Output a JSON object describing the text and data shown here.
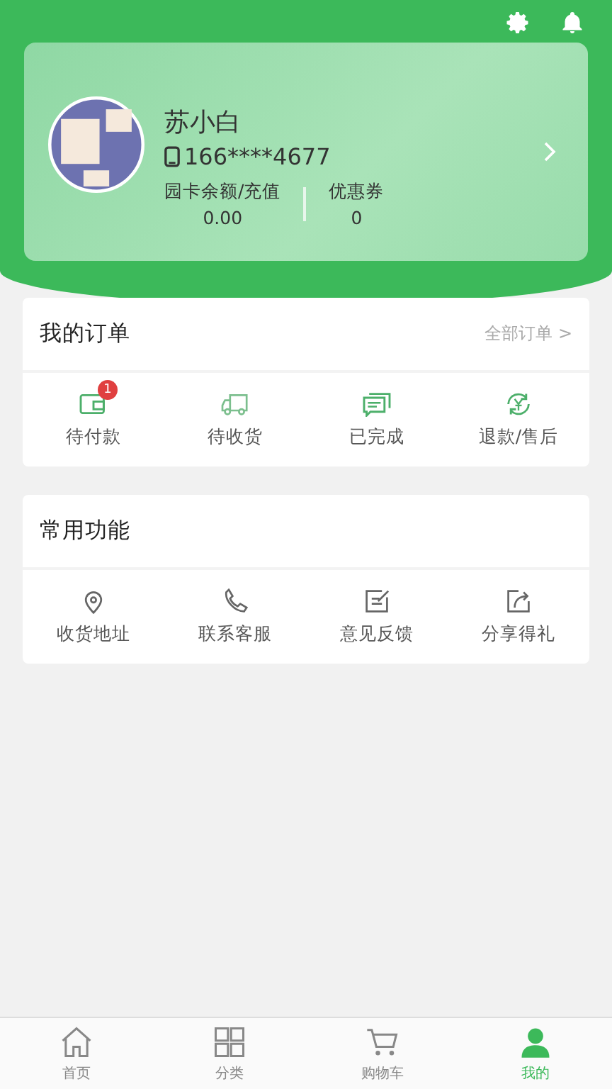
{
  "profile": {
    "name": "苏小白",
    "phone": "166****4677",
    "stats": [
      {
        "label": "园卡余额/充值",
        "value": "0.00"
      },
      {
        "label": "优惠券",
        "value": "0"
      }
    ]
  },
  "orders": {
    "title": "我的订单",
    "link": "全部订单 >",
    "items": [
      {
        "kind": "wallet",
        "label": "待付款",
        "badge": "1"
      },
      {
        "kind": "truck",
        "label": "待收货"
      },
      {
        "kind": "chat",
        "label": "已完成"
      },
      {
        "kind": "refund",
        "label": "退款/售后"
      }
    ]
  },
  "functions": {
    "title": "常用功能",
    "items": [
      {
        "kind": "pin",
        "label": "收货地址"
      },
      {
        "kind": "phone",
        "label": "联系客服"
      },
      {
        "kind": "edit",
        "label": "意见反馈"
      },
      {
        "kind": "share",
        "label": "分享得礼"
      }
    ]
  },
  "tabbar": [
    {
      "kind": "home",
      "label": "首页",
      "selected": false
    },
    {
      "kind": "grid",
      "label": "分类",
      "selected": false
    },
    {
      "kind": "cart",
      "label": "购物车",
      "selected": false
    },
    {
      "kind": "user",
      "label": "我的",
      "selected": true
    }
  ]
}
